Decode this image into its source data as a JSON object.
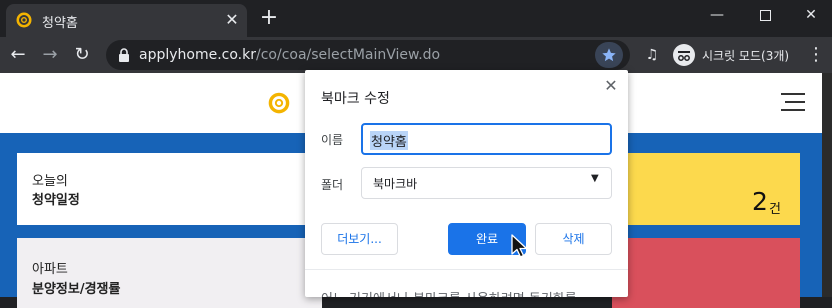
{
  "tab": {
    "title": "청약홈",
    "close_icon": "close-icon"
  },
  "window_controls": [
    "minimize-icon",
    "maximize-icon",
    "close-icon"
  ],
  "toolbar": {
    "url_host": "applyhome.co.kr",
    "url_path": "/co/coa/selectMainView.do",
    "incognito_label": "시크릿 모드(3개)"
  },
  "page": {
    "card1": {
      "line1": "오늘의",
      "line2": "청약일정"
    },
    "card2": {
      "count": "2",
      "unit": "건"
    },
    "card3": {
      "line1": "아파트",
      "line2": "분양정보/경쟁률"
    }
  },
  "dialog": {
    "title": "북마크 수정",
    "name_label": "이름",
    "name_value": "청약홈",
    "folder_label": "폴더",
    "folder_value": "북마크바",
    "more_button": "더보기...",
    "done_button": "완료",
    "delete_button": "삭제",
    "footer_text": "어느 기기에서나 북마크를 사용하려면 동기화를"
  },
  "colors": {
    "accent": "#1a73e8",
    "page_blue": "#1763b7",
    "yellow_card": "#fcd94d",
    "red_card": "#d9505c"
  }
}
